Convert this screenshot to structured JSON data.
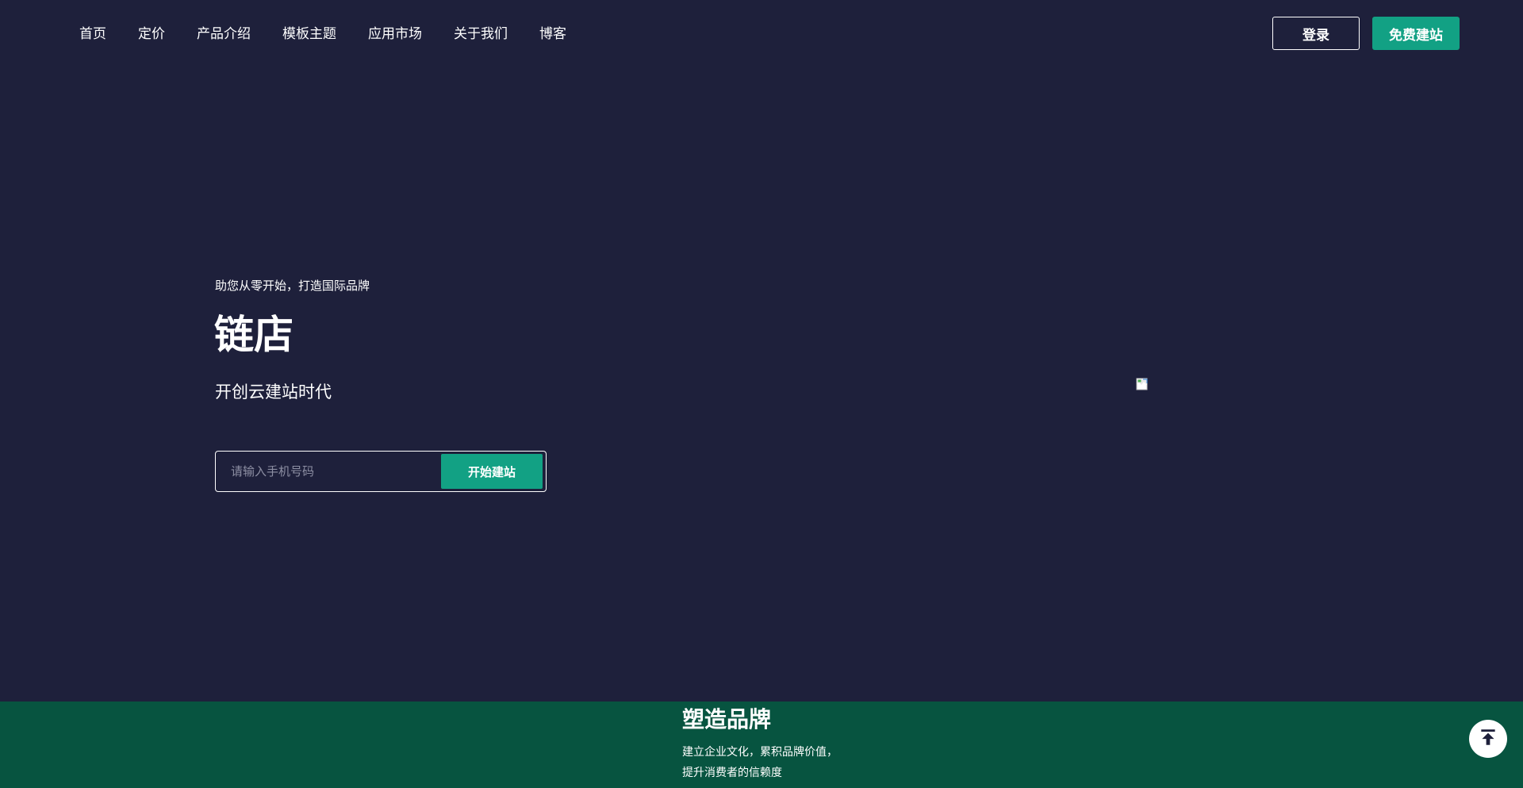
{
  "nav": {
    "links": [
      "首页",
      "定价",
      "产品介绍",
      "模板主题",
      "应用市场",
      "关于我们",
      "博客"
    ],
    "login_label": "登录",
    "free_site_label": "免费建站"
  },
  "hero": {
    "tagline": "助您从零开始，打造国际品牌",
    "title": "链店",
    "subtitle": "开创云建站时代",
    "phone_placeholder": "请输入手机号码",
    "start_button_label": "开始建站"
  },
  "feature": {
    "title": "塑造品牌",
    "desc_line1": "建立企业文化，累积品牌价值，",
    "desc_line2": "提升消费者的信赖度"
  },
  "icons": {
    "back_to_top": "arrow-up-to-top-icon",
    "hero_image": "broken-image-icon"
  },
  "colors": {
    "background": "#1e203b",
    "accent": "#12a184",
    "feature_band": "#075440",
    "text": "#ffffff"
  }
}
